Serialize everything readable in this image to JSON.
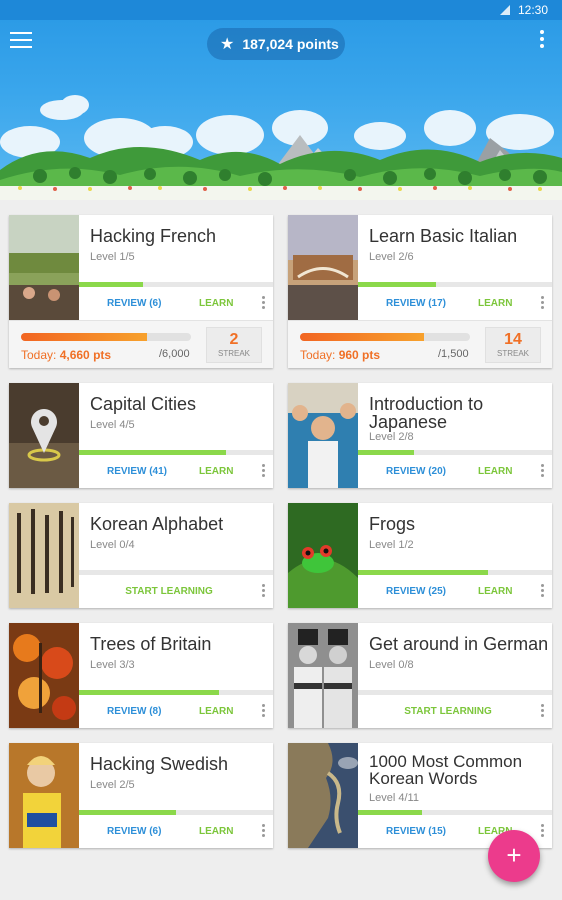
{
  "status_bar": {
    "time": "12:30"
  },
  "header": {
    "points": "187,024 points"
  },
  "courses": [
    {
      "title": "Hacking French",
      "level": "Level 1/5",
      "review": "REVIEW (6)",
      "learn": "LEARN",
      "progress": 0.33,
      "daily": {
        "today_label": "Today: ",
        "today_pts": "4,660 pts",
        "goal": "/6,000",
        "progress": 0.74,
        "streak": "2",
        "streak_label": "STREAK"
      }
    },
    {
      "title": "Learn Basic Italian",
      "level": "Level 2/6",
      "review": "REVIEW (17)",
      "learn": "LEARN",
      "progress": 0.4,
      "daily": {
        "today_label": "Today: ",
        "today_pts": "960 pts",
        "goal": "/1,500",
        "progress": 0.73,
        "streak": "14",
        "streak_label": "STREAK"
      }
    },
    {
      "title": "Capital Cities",
      "level": "Level 4/5",
      "review": "REVIEW (41)",
      "learn": "LEARN",
      "progress": 0.76
    },
    {
      "title": "Introduction to Japanese",
      "level": "Level 2/8",
      "review": "REVIEW (20)",
      "learn": "LEARN",
      "progress": 0.29
    },
    {
      "title": "Korean Alphabet",
      "level": "Level 0/4",
      "start": "START LEARNING",
      "progress": 0
    },
    {
      "title": "Frogs",
      "level": "Level 1/2",
      "review": "REVIEW (25)",
      "learn": "LEARN",
      "progress": 0.67
    },
    {
      "title": "Trees of Britain",
      "level": "Level 3/3",
      "review": "REVIEW (8)",
      "learn": "LEARN",
      "progress": 0.72
    },
    {
      "title": "Get around in German",
      "level": "Level 0/8",
      "start": "START LEARNING",
      "progress": 0
    },
    {
      "title": "Hacking Swedish",
      "level": "Level 2/5",
      "review": "REVIEW (6)",
      "learn": "LEARN",
      "progress": 0.5
    },
    {
      "title": "1000 Most Common Korean Words",
      "level": "Level 4/11",
      "review": "REVIEW (15)",
      "learn": "LEARN",
      "progress": 0.33
    }
  ],
  "fab": {
    "label": "+"
  },
  "colors": {
    "accent_blue": "#2d8fd8",
    "learn_green": "#7cc63b",
    "fab_pink": "#ec3b8c",
    "streak_orange": "#f07026"
  },
  "icons": [
    "hamburger-icon",
    "star-icon",
    "more-vert-icon",
    "signal-icon",
    "location-pin-icon",
    "add-icon"
  ]
}
